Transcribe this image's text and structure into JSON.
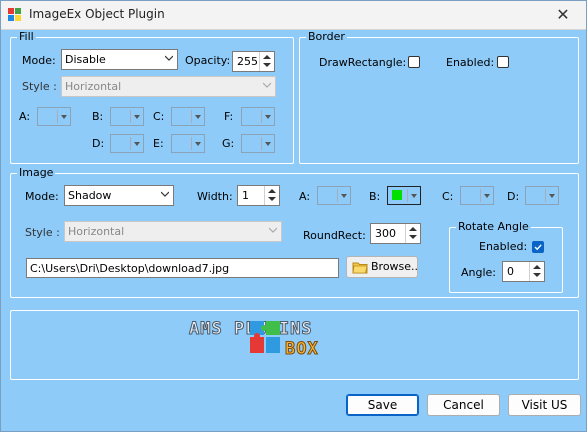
{
  "window": {
    "title": "ImageEx Object Plugin",
    "close_glyph": "✕"
  },
  "fill": {
    "legend": "Fill",
    "mode_label": "Mode:",
    "mode_value": "Disable",
    "opacity_label": "Opacity:",
    "opacity_value": "255",
    "style_label": "Style :",
    "style_value": "Horizontal",
    "color_labels": {
      "a": "A:",
      "b": "B:",
      "c": "C:",
      "d": "D:",
      "e": "E:",
      "f": "F:",
      "g": "G:"
    }
  },
  "border": {
    "legend": "Border",
    "draw_rectangle_label": "DrawRectangle:",
    "draw_rectangle_checked": false,
    "enabled_label": "Enabled:",
    "enabled_checked": false
  },
  "image": {
    "legend": "Image",
    "mode_label": "Mode:",
    "mode_value": "Shadow",
    "width_label": "Width:",
    "width_value": "1",
    "style_label": "Style :",
    "style_value": "Horizontal",
    "roundrect_label": "RoundRect:",
    "roundrect_value": "300",
    "color_labels": {
      "a": "A:",
      "b": "B:",
      "c": "C:",
      "d": "D:"
    },
    "b_color": "#00e000",
    "path_value": "C:\\Users\\Dri\\Desktop\\download7.jpg",
    "browse_label": "Browse..",
    "rotate": {
      "legend": "Rotate Angle",
      "enabled_label": "Enabled:",
      "enabled_checked": true,
      "angle_label": "Angle:",
      "angle_value": "0"
    }
  },
  "logo": {
    "line1": "AMS  PLUGINS",
    "line2": "BOX"
  },
  "buttons": {
    "save": "Save",
    "cancel": "Cancel",
    "visit": "Visit US"
  },
  "colors": {
    "background": "#8fcbf9",
    "accent": "#0a64c8"
  }
}
